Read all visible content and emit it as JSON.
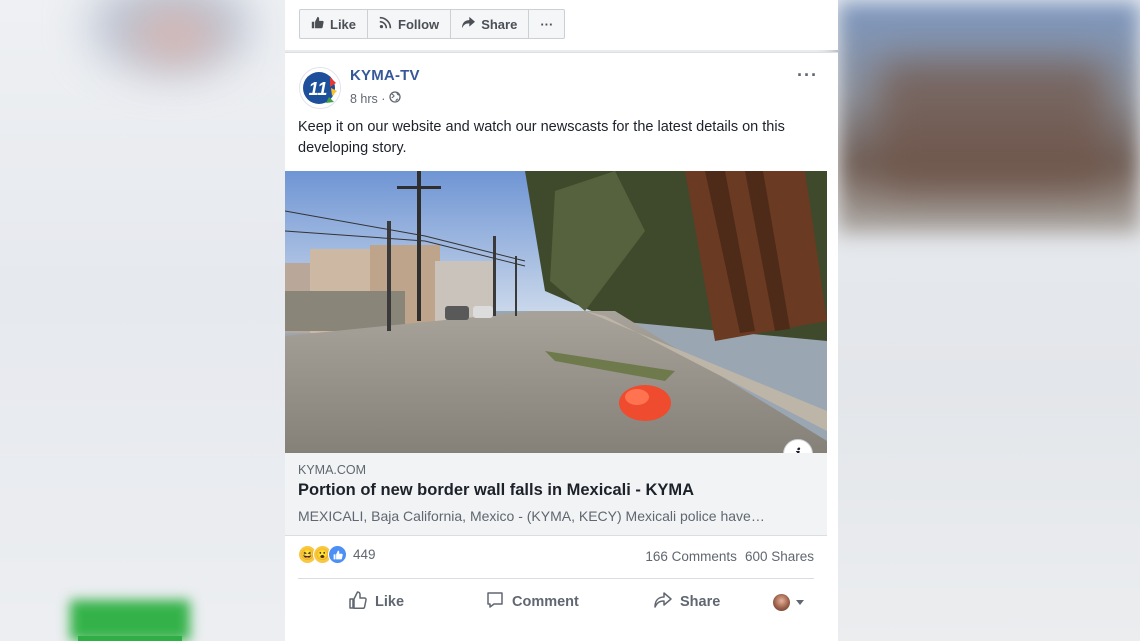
{
  "toolbar": {
    "like_label": "Like",
    "follow_label": "Follow",
    "share_label": "Share",
    "more_label": "···"
  },
  "post": {
    "page_name": "KYMA-TV",
    "avatar_text": "11",
    "time": "8 hrs ·",
    "more_label": "···",
    "text": "Keep it on our website and watch our newscasts for the latest details on this developing story.",
    "link": {
      "domain": "KYMA.COM",
      "title": "Portion of new border wall falls in Mexicali - KYMA",
      "description": "MEXICALI, Baja California, Mexico - (KYMA, KECY) Mexicali police have…",
      "info_label": "i"
    },
    "reactions": {
      "icons": [
        "haha-icon",
        "wow-icon",
        "like-icon"
      ],
      "count": "449"
    },
    "comments_count": "166 Comments",
    "shares_count": "600 Shares",
    "actions": {
      "like": "Like",
      "comment": "Comment",
      "share": "Share"
    }
  },
  "colors": {
    "link_blue": "#365899",
    "text_dark": "#1d2129",
    "text_gray": "#606770",
    "like_blue": "#4c8ff5",
    "emoji_yellow": "#f7c843"
  }
}
